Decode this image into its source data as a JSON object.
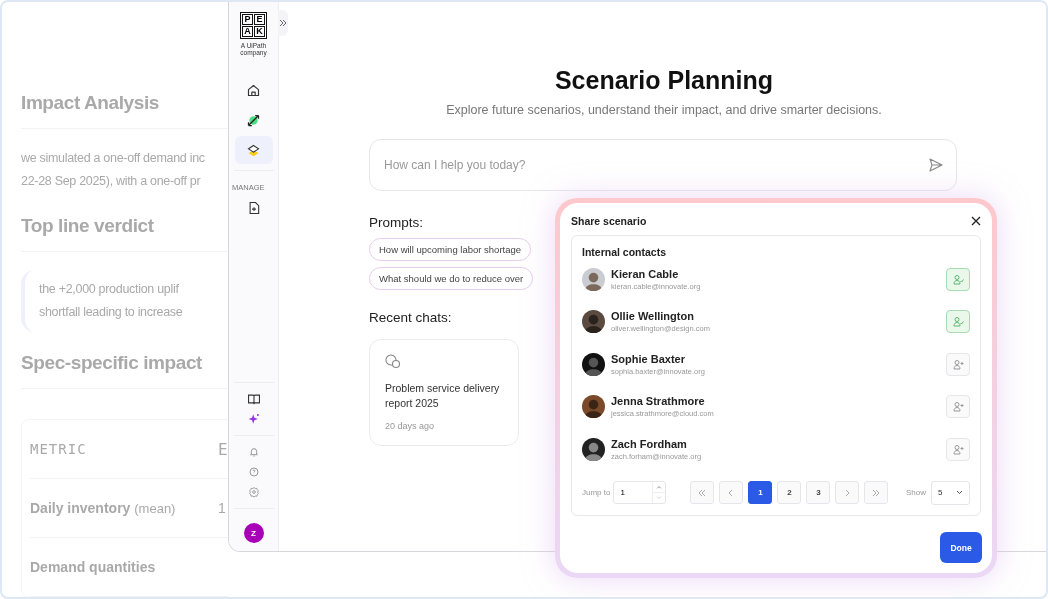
{
  "background_page": {
    "heading": "Impact Analysis",
    "intro_lines": [
      "we simulated a one-off demand inc",
      "22-28 Sep 2025), with a one-off pr"
    ],
    "verdict_heading": "Top line verdict",
    "quote_lines": [
      "the +2,000 production uplif",
      "shortfall leading to increase"
    ],
    "impact_heading": "Spec-specific impact",
    "table": {
      "columns": [
        "METRIC",
        "E"
      ],
      "rows": [
        {
          "metric": "Daily inventory",
          "note": "(mean)",
          "value": "1"
        },
        {
          "metric": "Demand quantities"
        }
      ]
    }
  },
  "sidebar": {
    "logo_letters": [
      "P",
      "E",
      "A",
      "K"
    ],
    "logo_caption": "A UiPath company",
    "nav_items": [
      {
        "kind": "home",
        "selected": false
      },
      {
        "kind": "arrows",
        "selected": false
      },
      {
        "kind": "layers",
        "selected": true
      }
    ],
    "section_label": "MANAGE",
    "manage_items": [
      {
        "kind": "file"
      }
    ],
    "bottom_items": [
      {
        "kind": "book"
      },
      {
        "kind": "sparkle"
      }
    ],
    "utility_items": [
      {
        "kind": "bell"
      },
      {
        "kind": "help"
      },
      {
        "kind": "settings"
      }
    ],
    "user_initial": "Z"
  },
  "main": {
    "title": "Scenario Planning",
    "subtitle": "Explore future scenarios, understand their impact, and drive smarter decisions.",
    "prompt_field": {
      "placeholder": "How can I help you today?"
    },
    "prompts_label": "Prompts:",
    "prompts": [
      "How will upcoming labor shortage",
      "What should we do to reduce over"
    ],
    "recent_label": "Recent chats:",
    "chats": [
      {
        "title": "Problem service delivery report 2025",
        "time": "20 days ago"
      }
    ]
  },
  "share_dialog": {
    "title": "Share scenario",
    "section": "Internal contacts",
    "contacts": [
      {
        "name": "Kieran Cable",
        "email": "kieran.cable@innovate.org",
        "added": true
      },
      {
        "name": "Ollie Wellington",
        "email": "oliver.wellington@design.com",
        "added": true
      },
      {
        "name": "Sophie Baxter",
        "email": "sophia.baxter@innovate.org",
        "added": false
      },
      {
        "name": "Jenna Strathmore",
        "email": "jessica.strathmore@cloud.com",
        "added": false
      },
      {
        "name": "Zach Fordham",
        "email": "zach.forham@innovate.org",
        "added": false
      }
    ],
    "pagination": {
      "jump_label": "Jump to",
      "jump_value": "1",
      "pages": [
        {
          "label": "1",
          "selected": true
        },
        {
          "label": "2",
          "selected": false
        },
        {
          "label": "3",
          "selected": false
        }
      ],
      "show_label": "Show",
      "page_size": "5"
    },
    "done_button": "Done"
  }
}
